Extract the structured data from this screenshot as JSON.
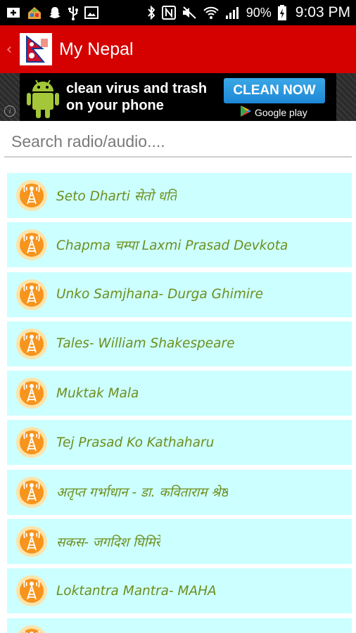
{
  "status_bar": {
    "battery_percent": "90%",
    "time": "9:03 PM",
    "left_icons": [
      "add-icon",
      "home-notification-icon",
      "snapchat-icon",
      "usb-icon",
      "image-icon"
    ],
    "right_icons": [
      "bluetooth-icon",
      "nfc-icon",
      "mute-icon",
      "wifi-icon",
      "signal-icon",
      "battery-charging-icon"
    ]
  },
  "action_bar": {
    "title": "My Nepal",
    "back_icon": "chevron-left-icon",
    "color": "#d50000"
  },
  "ad": {
    "line1": "clean virus and trash",
    "line2": "on your phone",
    "cta": "CLEAN NOW",
    "store": "Google play",
    "info": "i"
  },
  "search": {
    "placeholder": "Search radio/audio....",
    "value": ""
  },
  "list": {
    "items": [
      {
        "label": "Seto Dharti सेतो धर्ति"
      },
      {
        "label": "Chapma चम्पा Laxmi Prasad Devkota"
      },
      {
        "label": "Unko Samjhana-  Durga Ghimire"
      },
      {
        "label": "Tales- William Shakespeare"
      },
      {
        "label": "Muktak Mala"
      },
      {
        "label": "Tej Prasad Ko Kathaharu"
      },
      {
        "label": "अतृप्त गर्भाधान -  डा. कविताराम श्रेष्ठ"
      },
      {
        "label": "सकस-  जगदिश घिमिरे"
      },
      {
        "label": "Loktantra Mantra- MAHA"
      },
      {
        "label": ""
      }
    ],
    "item_icon": "radio-tower-icon",
    "item_bg": "#ccffff",
    "text_color": "#6e8e1d"
  }
}
